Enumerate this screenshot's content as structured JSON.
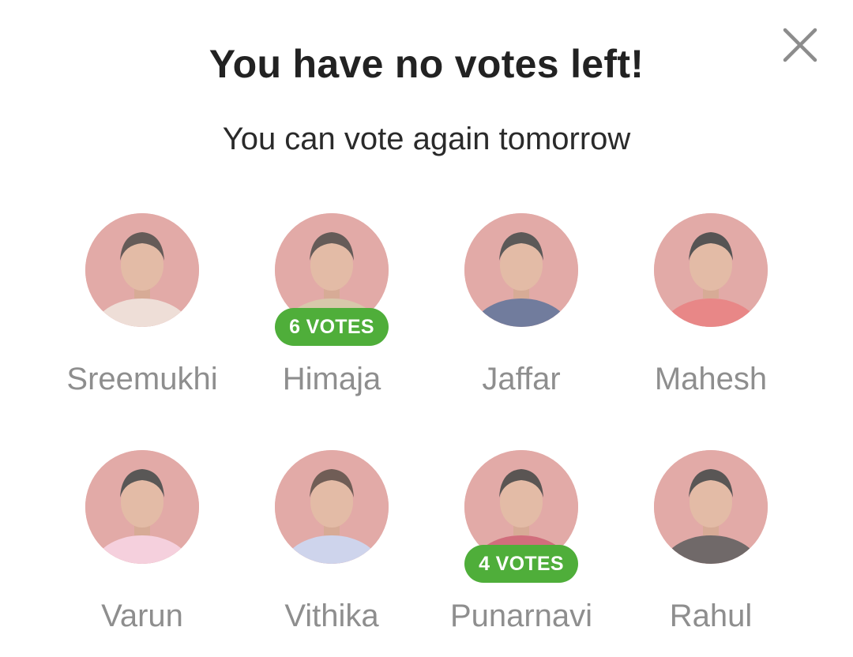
{
  "dialog": {
    "title": "You have no votes left!",
    "subtitle": "You can vote again tomorrow",
    "close_icon": "close-icon"
  },
  "colors": {
    "badge": "#4fae3a",
    "avatar_bg": "#d88a86",
    "name_text": "#8e8e8e",
    "title_text": "#222222"
  },
  "contestants": [
    {
      "name": "Sreemukhi",
      "votes": null,
      "shirt": "#e8d2c8",
      "hair": "#2b1d18"
    },
    {
      "name": "Himaja",
      "votes": "6 VOTES",
      "shirt": "#c9b48a",
      "hair": "#2b1d18"
    },
    {
      "name": "Jaffar",
      "votes": null,
      "shirt": "#3b4a78",
      "hair": "#1e1a18"
    },
    {
      "name": "Mahesh",
      "votes": null,
      "shirt": "#e05a5a",
      "hair": "#161313"
    },
    {
      "name": "Varun",
      "votes": null,
      "shirt": "#f2bfd0",
      "hair": "#1a1716"
    },
    {
      "name": "Vithika",
      "votes": null,
      "shirt": "#bcc4e6",
      "hair": "#3a2016"
    },
    {
      "name": "Punarnavi",
      "votes": "4 VOTES",
      "shirt": "#c0364a",
      "hair": "#1c1512"
    },
    {
      "name": "Rahul",
      "votes": null,
      "shirt": "#3a3030",
      "hair": "#1a1614"
    }
  ]
}
